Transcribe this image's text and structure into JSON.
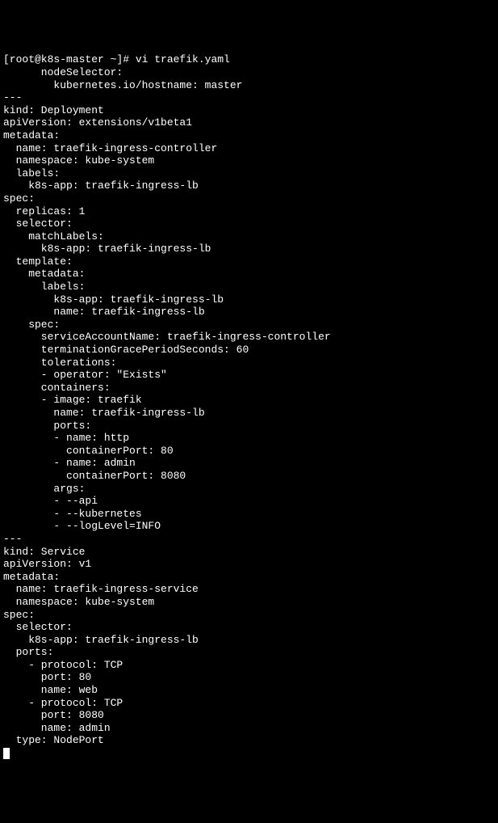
{
  "prompt": "[root@k8s-master ~]# vi traefik.yaml",
  "lines": [
    "      nodeSelector:",
    "        kubernetes.io/hostname: master",
    "---",
    "kind: Deployment",
    "apiVersion: extensions/v1beta1",
    "metadata:",
    "  name: traefik-ingress-controller",
    "  namespace: kube-system",
    "  labels:",
    "    k8s-app: traefik-ingress-lb",
    "spec:",
    "  replicas: 1",
    "  selector:",
    "    matchLabels:",
    "      k8s-app: traefik-ingress-lb",
    "  template:",
    "    metadata:",
    "      labels:",
    "        k8s-app: traefik-ingress-lb",
    "        name: traefik-ingress-lb",
    "    spec:",
    "      serviceAccountName: traefik-ingress-controller",
    "      terminationGracePeriodSeconds: 60",
    "      tolerations:",
    "      - operator: \"Exists\"",
    "      containers:",
    "      - image: traefik",
    "        name: traefik-ingress-lb",
    "        ports:",
    "        - name: http",
    "          containerPort: 80",
    "        - name: admin",
    "          containerPort: 8080",
    "        args:",
    "        - --api",
    "        - --kubernetes",
    "        - --logLevel=INFO",
    "---",
    "kind: Service",
    "apiVersion: v1",
    "metadata:",
    "  name: traefik-ingress-service",
    "  namespace: kube-system",
    "spec:",
    "  selector:",
    "    k8s-app: traefik-ingress-lb",
    "  ports:",
    "    - protocol: TCP",
    "      port: 80",
    "      name: web",
    "    - protocol: TCP",
    "      port: 8080",
    "      name: admin",
    "  type: NodePort"
  ]
}
